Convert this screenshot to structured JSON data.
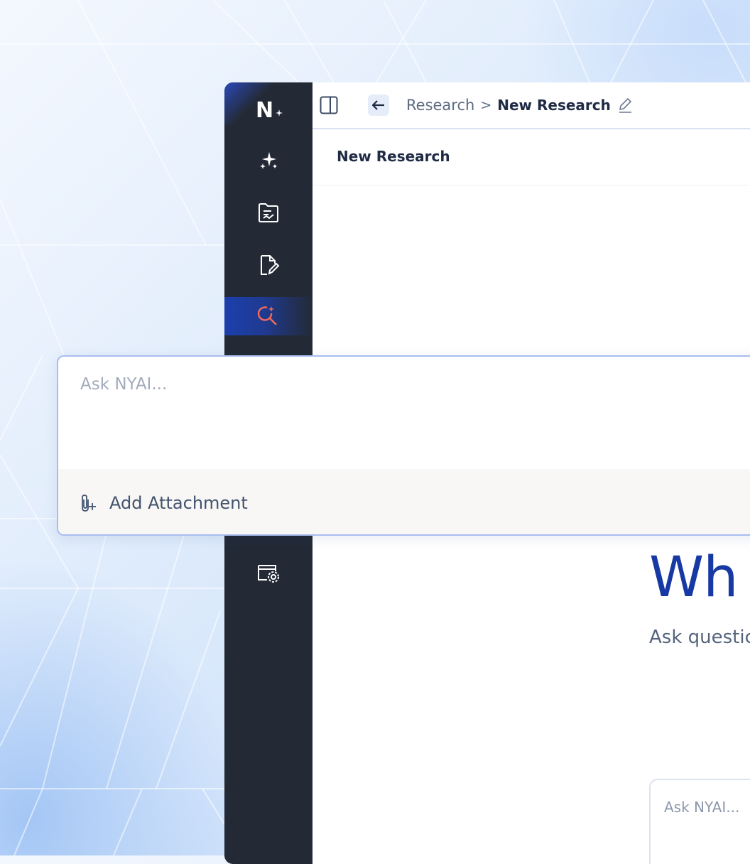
{
  "sidebar": {
    "logo_text": "N",
    "items": [
      {
        "icon": "sparkles-icon",
        "active": false
      },
      {
        "icon": "document-chart-icon",
        "active": false
      },
      {
        "icon": "file-edit-icon",
        "active": false
      },
      {
        "icon": "research-search-icon",
        "active": true
      },
      {
        "icon": "settings-window-icon",
        "active": false
      }
    ],
    "accent_color": "#f26b5b"
  },
  "topbar": {
    "breadcrumb_parent": "Research",
    "breadcrumb_separator": ">",
    "breadcrumb_current": "New Research"
  },
  "subheader": {
    "title": "New Research"
  },
  "main": {
    "hero_title": "Wh",
    "hero_subtitle": "Ask questic",
    "bottom_input_placeholder": "Ask NYAI..."
  },
  "ask_panel": {
    "placeholder": "Ask NYAI...",
    "attach_label": "Add Attachment"
  },
  "colors": {
    "sidebar_bg": "#232a36",
    "brand_blue": "#1739a3",
    "panel_border": "#a9bdf0"
  }
}
